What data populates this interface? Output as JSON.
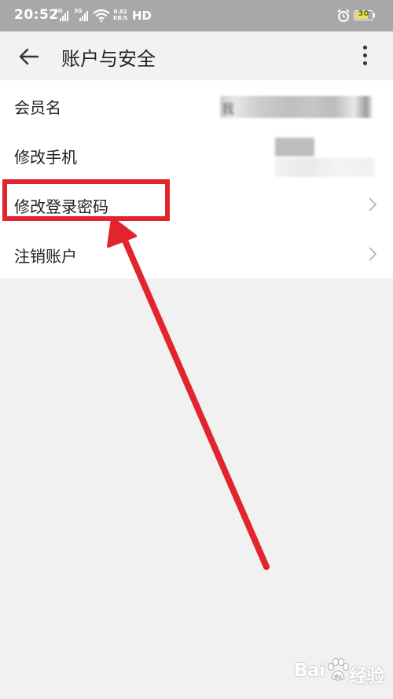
{
  "status_bar": {
    "time": "20:52",
    "network_1": "4G",
    "network_2": "3G",
    "speed_value": "0.82",
    "speed_unit": "KB/S",
    "hd_label": "HD",
    "battery_level": "30"
  },
  "app_bar": {
    "title": "账户与安全",
    "back_icon": "arrow-left-icon",
    "more_icon": "more-vertical-icon"
  },
  "settings_items": [
    {
      "label": "会员名",
      "value": "我"
    },
    {
      "label": "修改手机"
    },
    {
      "label": "修改登录密码",
      "icon": "chevron-right-icon",
      "highlighted": true
    },
    {
      "label": "注销账户",
      "icon": "chevron-right-icon"
    }
  ],
  "annotation": {
    "color": "#e2242d"
  },
  "watermark": {
    "text_left": "Bai",
    "text_right": "经验"
  }
}
